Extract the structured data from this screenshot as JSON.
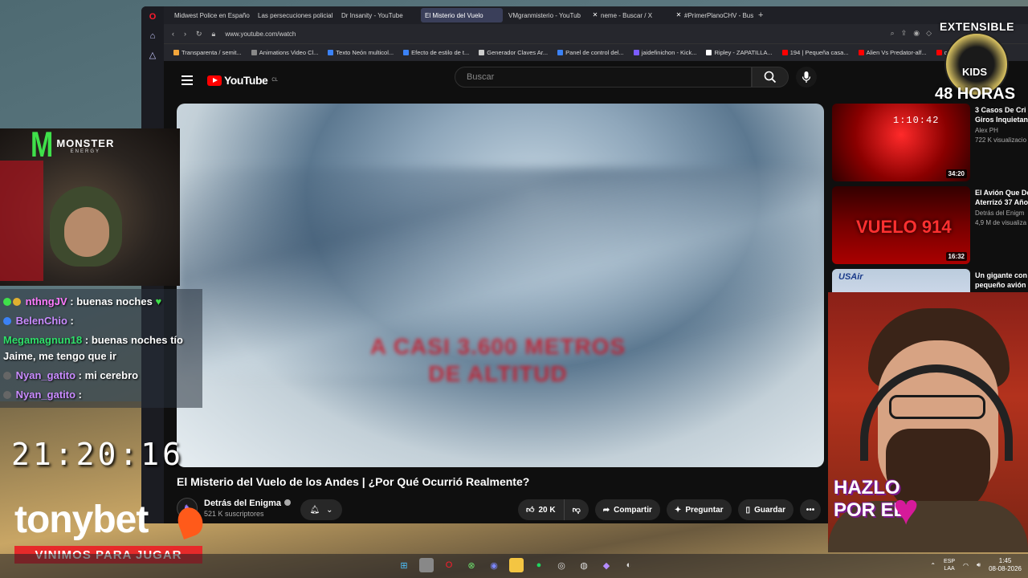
{
  "browser": {
    "tabs": [
      {
        "label": "Midwest Police en Españo",
        "icon": "youtube",
        "active": false
      },
      {
        "label": "Las persecuciones policial",
        "icon": "youtube",
        "active": false
      },
      {
        "label": "Dr Insanity - YouTube",
        "icon": "youtube",
        "active": false
      },
      {
        "label": "El Misterio del Vuelo",
        "icon": "youtube",
        "active": true
      },
      {
        "label": "VMgranmisterio - YouTub",
        "icon": "youtube",
        "active": false
      },
      {
        "label": "neme - Buscar / X",
        "icon": "x",
        "active": false
      },
      {
        "label": "#PrimerPlanoCHV - Buscar",
        "icon": "x",
        "active": false
      }
    ],
    "new_tab": "+",
    "url": "www.youtube.com/watch",
    "bookmarks": [
      "Transparenta / semit...",
      "Animations Video Cl...",
      "Texto Neón multicol...",
      "Efecto de estilo de t...",
      "Generador Claves Ar...",
      "Panel de control del...",
      "jaidefinichon - Kick...",
      "Ripley - ZAPATILLA...",
      "194 | Pequeña casa...",
      "Alien Vs Predator-alf...",
      "cre"
    ]
  },
  "youtube": {
    "logo_text": "YouTube",
    "region": "CL",
    "search_placeholder": "Buscar",
    "video_overlay_text": "A CASI 3.600 METROS DE ALTITUD",
    "video_title": "El Misterio del Vuelo de los Andes | ¿Por Qué Ocurrió Realmente?",
    "channel_name": "Detrás del Enigma",
    "subscribers": "521 K suscriptores",
    "likes": "20 K",
    "share_label": "Compartir",
    "ask_label": "Preguntar",
    "save_label": "Guardar",
    "recommendations": [
      {
        "title": "3 Casos De Cri",
        "title2": "Giros Inquietan",
        "channel": "Alex PH",
        "views": "722 K visualizacio",
        "duration": "34:20",
        "timestamp": "1:10:42"
      },
      {
        "title": "El Avión Que De",
        "title2": "Aterrizó 37 Año",
        "channel": "Detrás del Enigm",
        "views": "4,9 M de visualiza",
        "duration": "16:32",
        "thumb_text": "VUELO 914"
      },
      {
        "title": "Un gigante con",
        "title2": "pequeño avión",
        "channel": "",
        "views": "",
        "duration": "",
        "thumb_text": "USAir"
      }
    ]
  },
  "stream": {
    "chat": [
      {
        "user": "nthngJV",
        "message": ": buenas noches"
      },
      {
        "user": "BelenChio",
        "message": ":"
      },
      {
        "user": "Megamagnun18",
        "message": ": buenas noches tío Jaime, me tengo que ir"
      },
      {
        "user": "Nyan_gatito",
        "message": ": mi cerebro"
      },
      {
        "user": "Nyan_gatito",
        "message": ":"
      }
    ],
    "clock": "21:20:16",
    "sponsor": "tonybet",
    "sponsor_tagline": "VINIMOS PARA JUGAR",
    "monster_brand": "MONSTER",
    "monster_sub": "ENERGY",
    "event_top": "EXTENSIBLE",
    "event_mid": "KIDS",
    "event_bottom": "48 HORAS",
    "hazlo_text": "HAZLO POR EL"
  },
  "taskbar": {
    "lang_top": "ESP",
    "lang_bottom": "LAA",
    "time": "1:45",
    "date": "08-08-2026"
  },
  "colors": {
    "youtube_red": "#ff0000",
    "chat_user_pink": "#ff7bff",
    "chat_user_green": "#2fe06a",
    "tonybet_red": "#e62a2a"
  }
}
